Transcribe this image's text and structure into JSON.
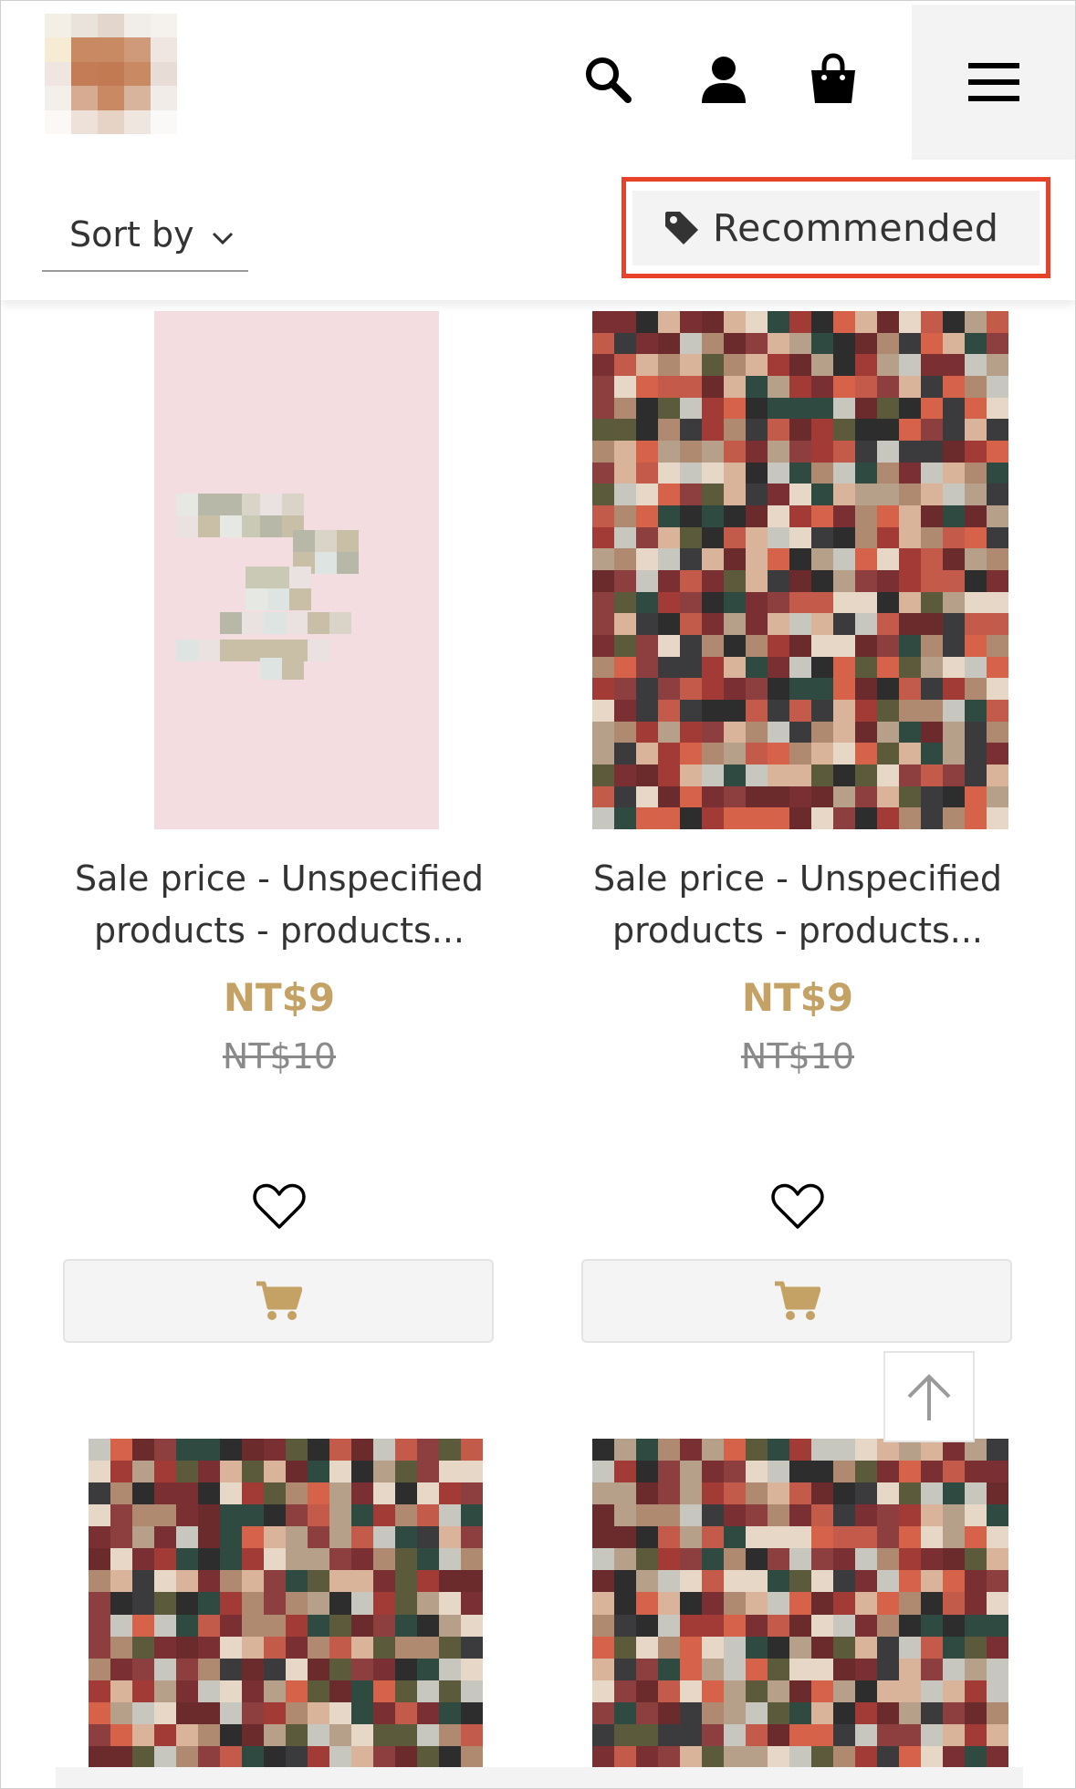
{
  "header": {
    "logo_alt": "store-logo",
    "icons": [
      "search-icon",
      "user-icon",
      "shopping-bag-icon",
      "hamburger-menu-icon"
    ]
  },
  "sortbar": {
    "sort_label": "Sort by",
    "recommended_label": "Recommended"
  },
  "colors": {
    "price": "#c4a265",
    "highlight": "#e8422b",
    "button_bg": "#f3f3f3"
  },
  "products": [
    {
      "title_line1": "Sale price - Unspecified",
      "title_line2": "products - products...",
      "price": "NT$9",
      "old_price": "NT$10"
    },
    {
      "title_line1": "Sale price - Unspecified",
      "title_line2": "products - products...",
      "price": "NT$9",
      "old_price": "NT$10"
    }
  ]
}
